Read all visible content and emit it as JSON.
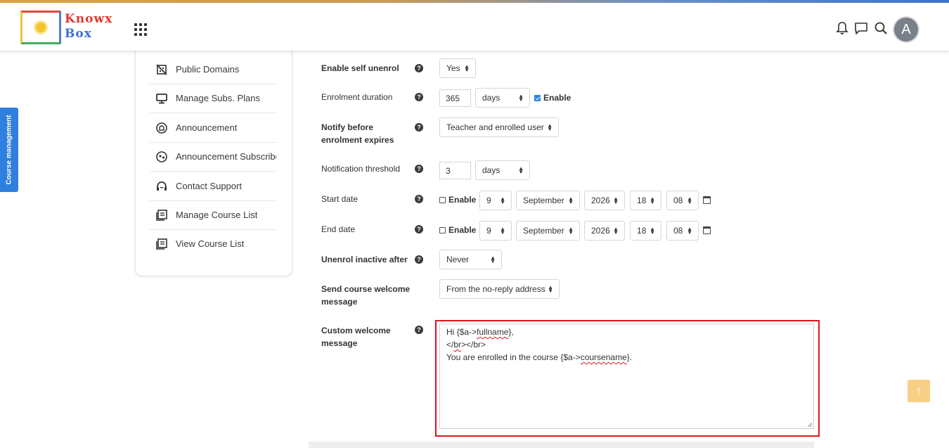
{
  "header": {
    "logo_line1": "Knowx",
    "logo_line2": "Box",
    "avatar_initial": "A"
  },
  "side_tab": {
    "label": "Course management"
  },
  "sidebar": {
    "items": [
      {
        "label": "Public Domains",
        "icon": "public-domains-icon"
      },
      {
        "label": "Manage Subs. Plans",
        "icon": "monitor-icon"
      },
      {
        "label": "Announcement",
        "icon": "announcement-icon"
      },
      {
        "label": "Announcement Subscribe",
        "icon": "subscriber-icon"
      },
      {
        "label": "Contact Support",
        "icon": "support-icon"
      },
      {
        "label": "Manage Course List",
        "icon": "list-icon"
      },
      {
        "label": "View Course List",
        "icon": "list-icon"
      }
    ]
  },
  "form": {
    "self_unenrol": {
      "label": "Enable self unenrol",
      "value": "Yes"
    },
    "enrolment_duration": {
      "label": "Enrolment duration",
      "value": "365",
      "unit": "days",
      "enable_label": "Enable",
      "enabled": true
    },
    "notify_before": {
      "label": "Notify before enrolment expires",
      "value": "Teacher and enrolled user"
    },
    "notification_threshold": {
      "label": "Notification threshold",
      "value": "3",
      "unit": "days"
    },
    "start_date": {
      "label": "Start date",
      "enable_label": "Enable",
      "day": "9",
      "month": "September",
      "year": "2026",
      "hour": "18",
      "minute": "08"
    },
    "end_date": {
      "label": "End date",
      "enable_label": "Enable",
      "day": "9",
      "month": "September",
      "year": "2026",
      "hour": "18",
      "minute": "08"
    },
    "unenrol_inactive": {
      "label": "Unenrol inactive after",
      "value": "Never"
    },
    "welcome_message": {
      "label": "Send course welcome message",
      "value": "From the no-reply address"
    },
    "custom_welcome": {
      "label": "Custom welcome message",
      "line1_pre": "Hi {$a->",
      "line1_word": "fullname",
      "line1_post": "},",
      "line2_pre": "</",
      "line2_word": "br",
      "line2_post": "></br>",
      "line3_pre": "You are enrolled in the course {$a->",
      "line3_word": "coursename",
      "line3_post": "}."
    }
  },
  "colors": {
    "accent": "#2f7fde",
    "highlight": "#e0151b",
    "back_to_top": "#f9cf86"
  }
}
